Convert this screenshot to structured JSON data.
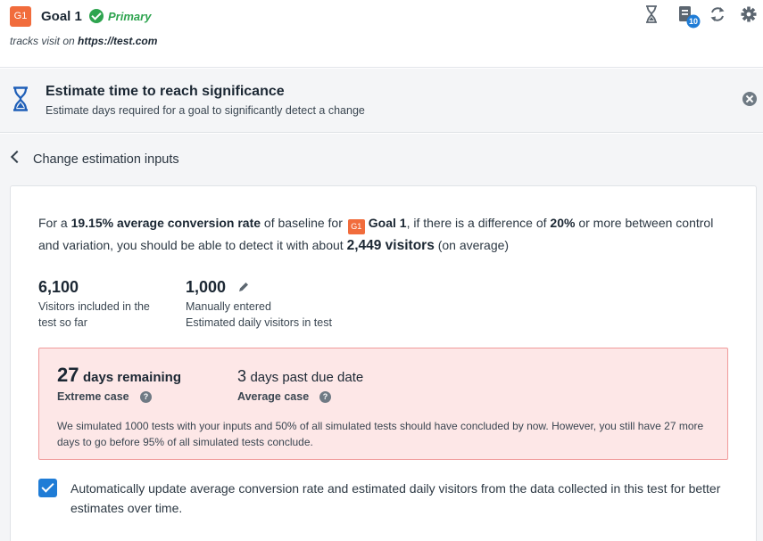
{
  "header": {
    "goal_badge": "G1",
    "goal_name": "Goal 1",
    "primary_label": "Primary",
    "tracks_prefix": "tracks visit on ",
    "tracks_url": "https://test.com",
    "notification_count": "10",
    "icons": [
      "hourglass-icon",
      "document-icon",
      "refresh-icon",
      "gear-icon"
    ]
  },
  "estimate": {
    "title": "Estimate time to reach significance",
    "subtitle": "Estimate days required for a goal to significantly detect a change"
  },
  "back": {
    "label": "Change estimation inputs"
  },
  "summary": {
    "p1": "For a ",
    "rate": "19.15% average conversion rate",
    "p2": " of baseline for ",
    "badge": "G1",
    "goal": "Goal 1",
    "p3": ", if there is a difference of ",
    "diff": "20%",
    "p4": " or more between control and variation, you should be able to detect it with about ",
    "visitors": "2,449 visitors",
    "p5": " (on average)"
  },
  "stats": {
    "included_value": "6,100",
    "included_label_1": "Visitors included in the",
    "included_label_2": "test so far",
    "daily_value": "1,000",
    "daily_label_1": "Manually entered",
    "daily_label_2": "Estimated daily visitors in test"
  },
  "alert": {
    "remaining_num": "27",
    "remaining_text": "days remaining",
    "remaining_sub": "Extreme case",
    "past_num": "3",
    "past_text": "days past due date",
    "past_sub": "Average case",
    "help_glyph": "?",
    "text": "We simulated 1000 tests with your inputs and 50% of all simulated tests should have concluded by now. However, you still have 27 more days to go before 95% of all simulated tests conclude."
  },
  "auto_update": {
    "checked": true,
    "label": "Automatically update average conversion rate and estimated daily visitors from the data collected in this test for better estimates over time."
  },
  "colors": {
    "badge": "#f16c3c",
    "primary_green": "#2ea44f",
    "alert_bg": "#fde7e7",
    "alert_border": "#f09a9a",
    "accent_blue": "#1f7cd6"
  }
}
